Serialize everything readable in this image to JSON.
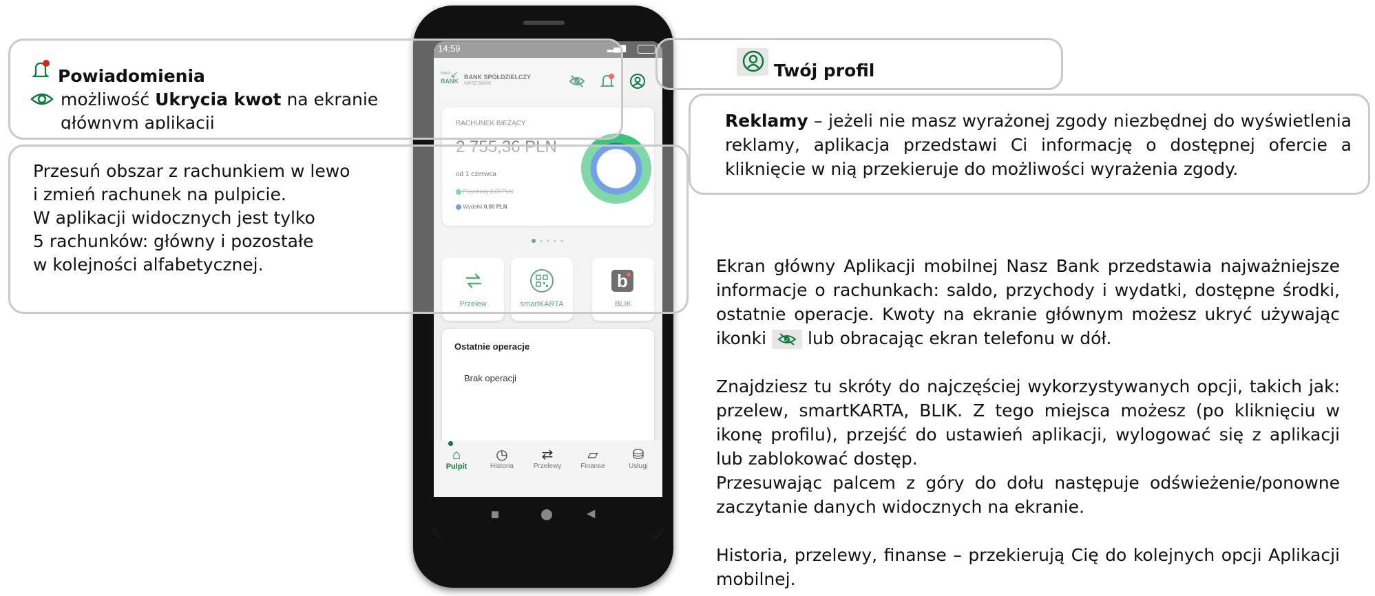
{
  "phone": {
    "status_time": "14:59",
    "bank_name": "BANK SPÓŁDZIELCZY",
    "bank_sub": "NASZ BANK",
    "logo_small": "Nasz",
    "logo_text": "BANK",
    "account_label": "RACHUNEK BIEŻĄCY",
    "balance": "2 755,36 PLN",
    "since": "od 1 czerwca",
    "income_label": "Przychody",
    "income_value": "0,00 PLN",
    "expense_label": "Wydatki",
    "expense_value": "0,00 PLN",
    "tiles": [
      {
        "label": "Przelew",
        "icon": "transfer-icon"
      },
      {
        "label": "smartKARTA",
        "icon": "smartkarta-icon"
      },
      {
        "label": "BLIK",
        "icon": "blik-icon"
      }
    ],
    "recent_title": "Ostatnie operacje",
    "recent_empty": "Brak operacji",
    "tabs": [
      {
        "label": "Pulpit",
        "icon": "home-icon"
      },
      {
        "label": "Historia",
        "icon": "history-icon"
      },
      {
        "label": "Przelewy",
        "icon": "transfers-icon"
      },
      {
        "label": "Finanse",
        "icon": "finance-icon"
      },
      {
        "label": "Usługi",
        "icon": "services-icon"
      }
    ]
  },
  "callouts": {
    "notifications_title": "Powiadomienia",
    "hide_prefix": "możliwość ",
    "hide_bold": "Ukrycia kwot",
    "hide_suffix": " na ekranie",
    "hide_line2": "głównym aplikacji",
    "swipe_lines": [
      "Przesuń obszar z rachunkiem w lewo",
      "i zmień rachunek na pulpicie.",
      "W aplikacji widocznych jest tylko",
      "5 rachunków: główny i pozostałe",
      "w kolejności alfabetycznej."
    ],
    "profile_title": "Twój profil",
    "ads_bold": "Reklamy",
    "ads_text": " – jeżeli nie masz wyrażonej zgody niezbędnej do wyświetlenia reklamy, aplikacja przedstawi Ci informację o dostępnej ofercie a kliknięcie w nią przekieruje do możliwości wyrażenia zgody."
  },
  "description": {
    "p1a": "Ekran główny Aplikacji mobilnej Nasz Bank przedstawia najważniejsze informacje o rachunkach: saldo, przychody i wydatki, dostępne środki, ostatnie operacje. Kwoty na ekranie głównym możesz ukryć używając ikonki",
    "p1b": " lub obracając ekran telefonu w dół.",
    "p2": "Znajdziesz tu skróty do najczęściej wykorzystywanych opcji, takich jak: przelew, smartKARTA, BLIK. Z tego miejsca możesz (po kliknięciu w ikonę profilu), przejść do ustawień aplikacji, wylogować się z aplikacji lub zablokować dostęp.",
    "p3": "Przesuwając palcem z góry do dołu następuje odświeżenie/ponowne zaczytanie danych widocznych na ekranie.",
    "p4": "Historia, przelewy, finanse – przekierują Cię do kolejnych opcji Aplikacji mobilnej."
  },
  "colors": {
    "brand_green": "#0a7a3b",
    "donut_green": "#3cc37a",
    "donut_blue": "#2a6fd6",
    "notification_dot": "#e0201b"
  }
}
